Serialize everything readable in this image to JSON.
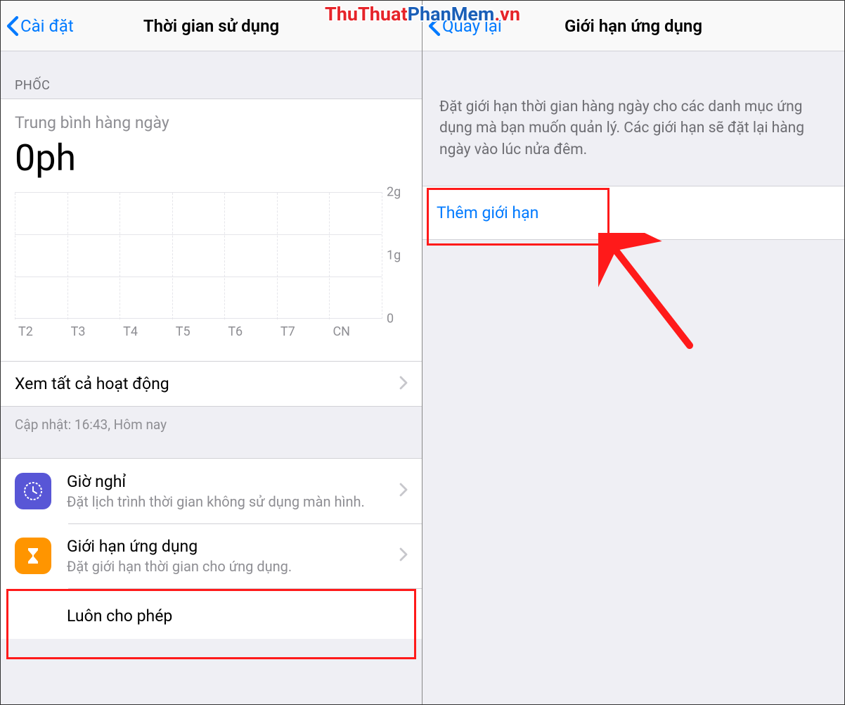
{
  "watermark": {
    "part1": "ThuThuat",
    "part2": "PhanMem",
    "part3": ".vn"
  },
  "left": {
    "nav": {
      "back": "Cài đặt",
      "title": "Thời gian sử dụng"
    },
    "section_header": "PHỐC",
    "avg_label": "Trung bình hàng ngày",
    "avg_value": "0ph",
    "view_all": "Xem tất cả hoạt động",
    "updated": "Cập nhật: 16:43, Hôm nay",
    "rows": {
      "downtime": {
        "title": "Giờ nghỉ",
        "sub": "Đặt lịch trình thời gian không sử dụng màn hình."
      },
      "applimits": {
        "title": "Giới hạn ứng dụng",
        "sub": "Đặt giới hạn thời gian cho ứng dụng."
      },
      "always": {
        "title": "Luôn cho phép"
      }
    }
  },
  "right": {
    "nav": {
      "back": "Quay lại",
      "title": "Giới hạn ứng dụng"
    },
    "desc": "Đặt giới hạn thời gian hàng ngày cho các danh mục ứng dụng mà bạn muốn quản lý. Các giới hạn sẽ đặt lại hàng ngày vào lúc nửa đêm.",
    "add": "Thêm giới hạn"
  },
  "chart_data": {
    "type": "bar",
    "categories": [
      "T2",
      "T3",
      "T4",
      "T5",
      "T6",
      "T7",
      "CN"
    ],
    "values": [
      0,
      0,
      0,
      0,
      0,
      0,
      0
    ],
    "title": "Trung bình hàng ngày",
    "xlabel": "",
    "ylabel": "",
    "ylim": [
      0,
      2
    ],
    "yticks": [
      "0",
      "1g",
      "2g"
    ]
  }
}
